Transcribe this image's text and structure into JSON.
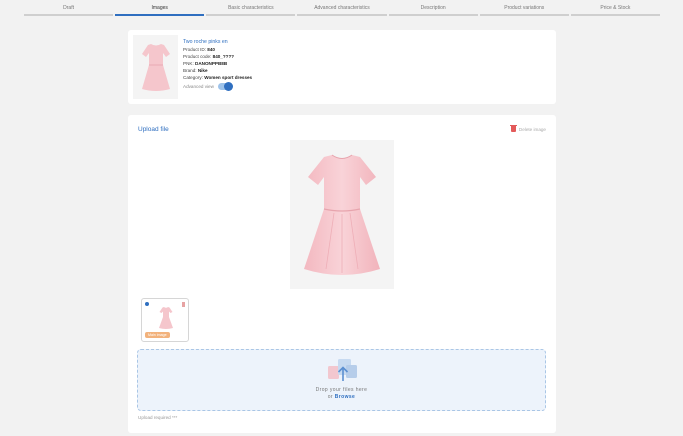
{
  "steps": [
    {
      "label": "Draft",
      "active": false
    },
    {
      "label": "Images",
      "active": true
    },
    {
      "label": "Basic characteristics",
      "active": false
    },
    {
      "label": "Advanced characteristics",
      "active": false
    },
    {
      "label": "Description",
      "active": false
    },
    {
      "label": "Product variations",
      "active": false
    },
    {
      "label": "Price & Stock",
      "active": false
    }
  ],
  "product": {
    "name": "Two roche pinks en",
    "id_label": "Product ID:",
    "id_value": "840",
    "code_label": "Product code:",
    "code_value": "840_????",
    "pnk_label": "PNK:",
    "pnk_value": "DANONPPB8B",
    "brand_label": "Brand:",
    "brand_value": "Nike",
    "category_label": "Category:",
    "category_value": "Women sport dresses",
    "advanced_view_label": "Advanced view",
    "advanced_view_on": true
  },
  "upload": {
    "title": "Upload file",
    "delete_label": "Delete image",
    "main_badge": "Main image",
    "drop_line1": "Drop your files here",
    "drop_or": "or",
    "browse_label": "Browse",
    "required_text": "Upload required ***"
  },
  "colors": {
    "accent": "#2f6fc0",
    "dress_pink": "#f5c6cc",
    "badge_orange": "#f2b27c",
    "delete_red": "#e35a5a",
    "dropzone_bg": "#edf3fb"
  },
  "icons": {
    "delete": "trash-icon",
    "upload": "upload-files-icon",
    "toggle": "toggle-switch"
  }
}
